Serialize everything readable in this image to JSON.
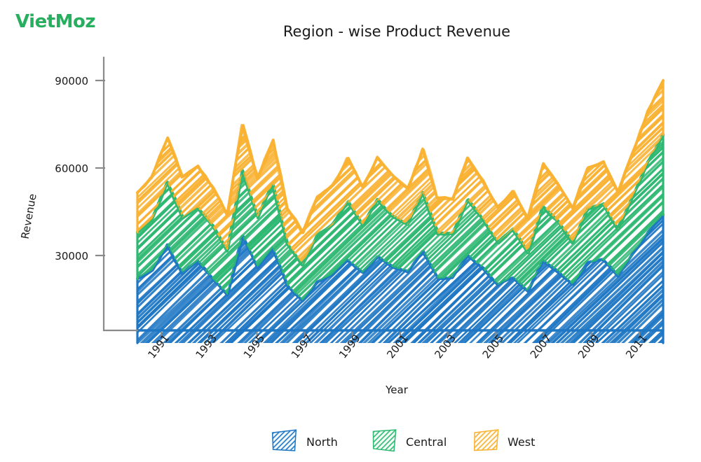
{
  "brand": {
    "name": "VietMoz",
    "color": "#27ae5f"
  },
  "chart_data": {
    "type": "area",
    "stacked": true,
    "title": "Region - wise Product Revenue",
    "xlabel": "Year",
    "ylabel": "Revenue",
    "grid": false,
    "legend_position": "bottom",
    "ylim": [
      0,
      100000
    ],
    "yticks": [
      30000,
      60000,
      90000
    ],
    "ytick_labels": [
      "30000",
      "60000",
      "90000"
    ],
    "xticks": [
      1991,
      1993,
      1995,
      1997,
      1999,
      2001,
      2003,
      2005,
      2007,
      2009,
      2011
    ],
    "xtick_labels": [
      "1991",
      "1993",
      "1995",
      "1997",
      "1999",
      "2001",
      "2003",
      "2005",
      "2007",
      "2009",
      "2011"
    ],
    "x": [
      1990,
      1991,
      1992,
      1993,
      1994,
      1995,
      1996,
      1997,
      1998,
      1999,
      2000,
      2001,
      2002,
      2003,
      2004,
      2005,
      2006,
      2007,
      2008,
      2009,
      2010,
      2011,
      2012
    ],
    "categories": [
      "1990",
      "1991",
      "1992",
      "1993",
      "1994",
      "1995",
      "1996",
      "1997",
      "1998",
      "1999",
      "2000",
      "2001",
      "2002",
      "2003",
      "2004",
      "2005",
      "2006",
      "2007",
      "2008",
      "2009",
      "2010",
      "2011",
      "2012"
    ],
    "series": [
      {
        "name": "North",
        "color": "#1f77c4",
        "values": [
          22000,
          25000,
          33500,
          24000,
          28000,
          22000,
          16500,
          36500,
          26000,
          32500,
          19500,
          14500,
          21000,
          23500,
          28500,
          24000,
          29500,
          26000,
          24500,
          31500,
          22000,
          22500,
          30000,
          25500,
          20000,
          22500,
          17500,
          28000,
          24500,
          20000,
          27500,
          28500,
          23000,
          30500,
          38000,
          44000
        ]
      },
      {
        "name": "Central",
        "color": "#2eb872",
        "values": [
          16000,
          17500,
          21500,
          19000,
          18500,
          18000,
          15000,
          22500,
          17000,
          22000,
          14500,
          12500,
          16000,
          17000,
          20000,
          16500,
          19500,
          17500,
          16000,
          20000,
          15500,
          15000,
          19000,
          17000,
          14500,
          16500,
          13500,
          19000,
          17000,
          14500,
          18500,
          19000,
          16000,
          20000,
          24000,
          27500
        ]
      },
      {
        "name": "West",
        "color": "#f9b233",
        "values": [
          13500,
          14500,
          15500,
          14000,
          14000,
          13500,
          12000,
          15500,
          13500,
          15000,
          12000,
          11000,
          13000,
          13500,
          15000,
          13000,
          14500,
          13500,
          12500,
          15000,
          12500,
          12000,
          14500,
          13000,
          12000,
          13000,
          11500,
          14500,
          13000,
          11500,
          14000,
          14500,
          12500,
          15000,
          17500,
          18500
        ]
      }
    ]
  },
  "legend": {
    "items": [
      {
        "label": "North",
        "color": "#1f77c4"
      },
      {
        "label": "Central",
        "color": "#2eb872"
      },
      {
        "label": "West",
        "color": "#f9b233"
      }
    ]
  }
}
